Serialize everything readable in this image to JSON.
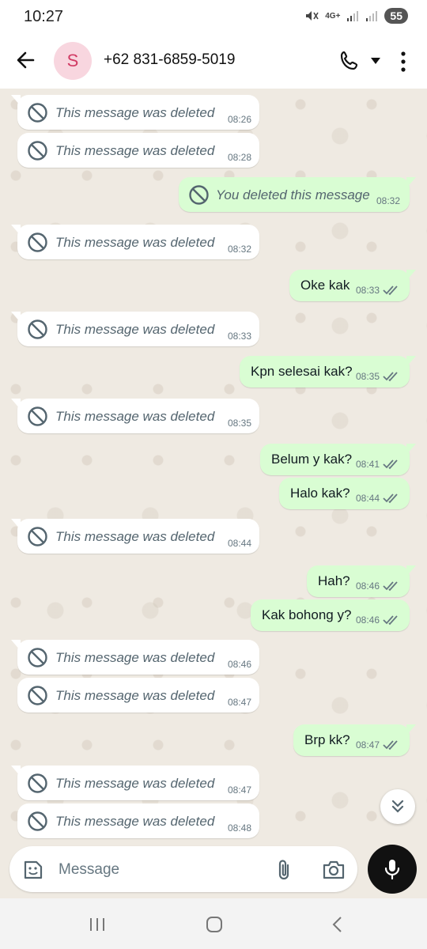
{
  "status_bar": {
    "time": "10:27",
    "network": "4G+",
    "battery": "55"
  },
  "header": {
    "avatar_letter": "S",
    "contact": "+62 831-6859-5019"
  },
  "messages": [
    {
      "dir": "in",
      "text": "This message was deleted",
      "time": "08:26",
      "deleted": true
    },
    {
      "dir": "in",
      "text": "This message was deleted",
      "time": "08:28",
      "deleted": true
    },
    {
      "dir": "out",
      "text": "You deleted this message",
      "time": "08:32",
      "deleted": true
    },
    {
      "dir": "in",
      "text": "This message was deleted",
      "time": "08:32",
      "deleted": true
    },
    {
      "dir": "out",
      "text": "Oke kak",
      "time": "08:33",
      "read": true
    },
    {
      "dir": "in",
      "text": "This message was deleted",
      "time": "08:33",
      "deleted": true
    },
    {
      "dir": "out",
      "text": "Kpn selesai kak?",
      "time": "08:35",
      "read": true
    },
    {
      "dir": "in",
      "text": "This message was deleted",
      "time": "08:35",
      "deleted": true
    },
    {
      "dir": "out",
      "text": "Belum y kak?",
      "time": "08:41",
      "read": true
    },
    {
      "dir": "out",
      "text": "Halo kak?",
      "time": "08:44",
      "read": true
    },
    {
      "dir": "in",
      "text": "This message was deleted",
      "time": "08:44",
      "deleted": true
    },
    {
      "dir": "out",
      "text": "Hah?",
      "time": "08:46",
      "read": true
    },
    {
      "dir": "out",
      "text": "Kak bohong y?",
      "time": "08:46",
      "read": true
    },
    {
      "dir": "in",
      "text": "This message was deleted",
      "time": "08:46",
      "deleted": true
    },
    {
      "dir": "in",
      "text": "This message was deleted",
      "time": "08:47",
      "deleted": true
    },
    {
      "dir": "out",
      "text": "Brp kk?",
      "time": "08:47",
      "read": true
    },
    {
      "dir": "in",
      "text": "This message was deleted",
      "time": "08:47",
      "deleted": true
    },
    {
      "dir": "in",
      "text": "This message was deleted",
      "time": "08:48",
      "deleted": true
    }
  ],
  "composer": {
    "placeholder": "Message"
  },
  "icons": {
    "back": "arrow-left-icon",
    "call": "phone-icon",
    "menu": "more-vert-icon",
    "emoji": "sticker-icon",
    "attach": "paperclip-icon",
    "camera": "camera-icon",
    "mic": "microphone-icon",
    "scroll": "double-chevron-down-icon",
    "deleted": "block-icon",
    "read": "double-check-icon"
  },
  "colors": {
    "incoming_bubble": "#ffffff",
    "outgoing_bubble": "#d9fdd3",
    "chat_background": "#efeae2",
    "read_ticks": "#667781",
    "avatar_bg": "#f8d6df",
    "avatar_fg": "#d13b64"
  }
}
